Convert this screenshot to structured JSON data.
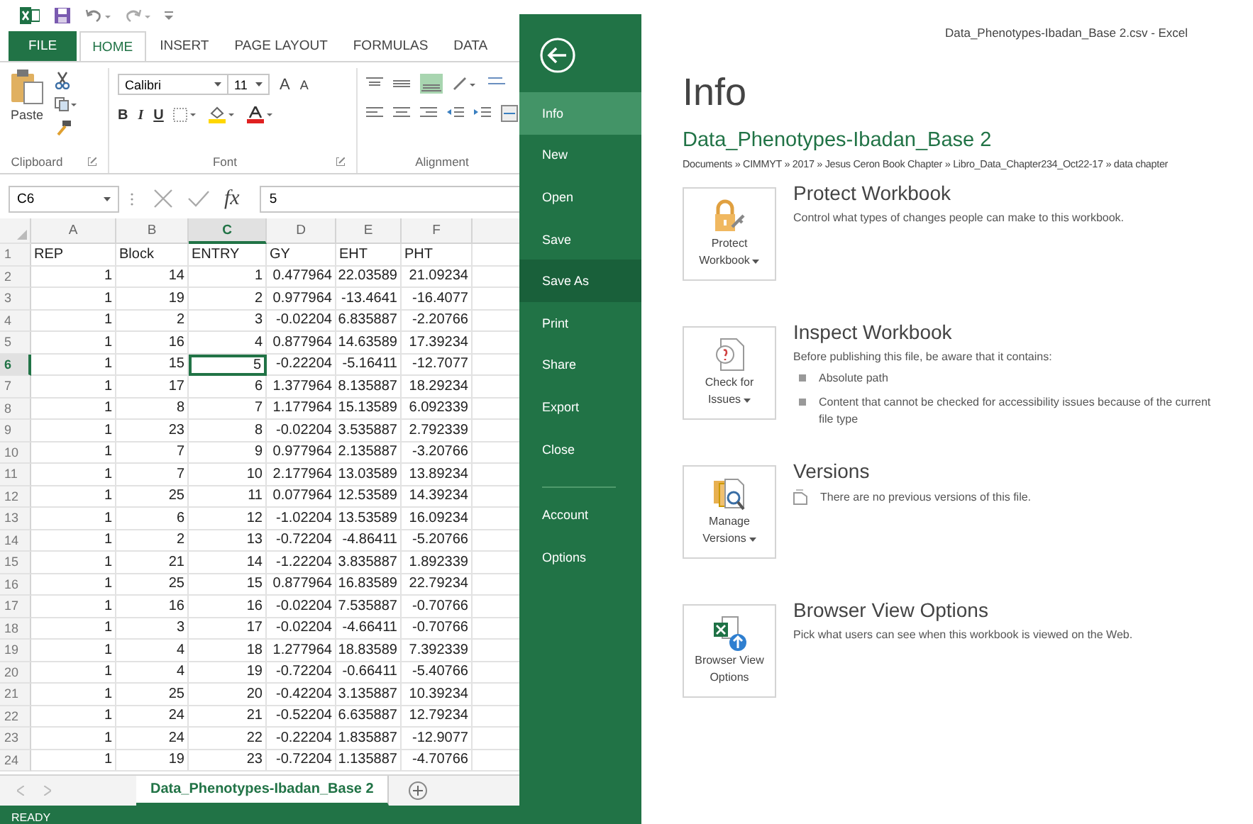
{
  "excel": {
    "ribbon": {
      "tabs": [
        {
          "label": "FILE",
          "kind": "file",
          "selected": false
        },
        {
          "label": "HOME",
          "kind": "tab",
          "selected": true
        },
        {
          "label": "INSERT",
          "kind": "tab",
          "selected": false
        },
        {
          "label": "PAGE LAYOUT",
          "kind": "tab",
          "selected": false
        },
        {
          "label": "FORMULAS",
          "kind": "tab",
          "selected": false
        },
        {
          "label": "DATA",
          "kind": "tab",
          "selected": false
        }
      ],
      "clipboard": {
        "label": "Clipboard",
        "paste": "Paste"
      },
      "font": {
        "label": "Font",
        "name": "Calibri",
        "size": "11",
        "size_buttons": [
          "A",
          "A"
        ],
        "style_buttons": [
          "B",
          "I",
          "U"
        ]
      },
      "alignment": {
        "label": "Alignment"
      }
    },
    "formula_bar": {
      "name_box": "C6",
      "function_label": "fx",
      "value": "5"
    },
    "sheet": {
      "columns": [
        {
          "label": "A",
          "selected": false
        },
        {
          "label": "B",
          "selected": false
        },
        {
          "label": "C",
          "selected": true
        },
        {
          "label": "D",
          "selected": false
        },
        {
          "label": "E",
          "selected": false
        },
        {
          "label": "F",
          "selected": false
        }
      ],
      "rows": [
        {
          "number": "1",
          "kind": "text",
          "selected": false,
          "cells": [
            "REP",
            "Block",
            "ENTRY",
            "GY",
            "EHT",
            "PHT"
          ]
        },
        {
          "number": "2",
          "kind": "number",
          "selected": false,
          "cells": [
            "1",
            "14",
            "1",
            "0.477964",
            "22.03589",
            "21.09234"
          ]
        },
        {
          "number": "3",
          "kind": "number",
          "selected": false,
          "cells": [
            "1",
            "19",
            "2",
            "0.977964",
            "-13.4641",
            "-16.4077"
          ]
        },
        {
          "number": "4",
          "kind": "number",
          "selected": false,
          "cells": [
            "1",
            "2",
            "3",
            "-0.02204",
            "6.835887",
            "-2.20766"
          ]
        },
        {
          "number": "5",
          "kind": "number",
          "selected": false,
          "cells": [
            "1",
            "16",
            "4",
            "0.877964",
            "14.63589",
            "17.39234"
          ]
        },
        {
          "number": "6",
          "kind": "number",
          "selected": true,
          "cells": [
            "1",
            "15",
            "5",
            "-0.22204",
            "-5.16411",
            "-12.7077"
          ]
        },
        {
          "number": "7",
          "kind": "number",
          "selected": false,
          "cells": [
            "1",
            "17",
            "6",
            "1.377964",
            "8.135887",
            "18.29234"
          ]
        },
        {
          "number": "8",
          "kind": "number",
          "selected": false,
          "cells": [
            "1",
            "8",
            "7",
            "1.177964",
            "15.13589",
            "6.092339"
          ]
        },
        {
          "number": "9",
          "kind": "number",
          "selected": false,
          "cells": [
            "1",
            "23",
            "8",
            "-0.02204",
            "3.535887",
            "2.792339"
          ]
        },
        {
          "number": "10",
          "kind": "number",
          "selected": false,
          "cells": [
            "1",
            "7",
            "9",
            "0.977964",
            "2.135887",
            "-3.20766"
          ]
        },
        {
          "number": "11",
          "kind": "number",
          "selected": false,
          "cells": [
            "1",
            "7",
            "10",
            "2.177964",
            "13.03589",
            "13.89234"
          ]
        },
        {
          "number": "12",
          "kind": "number",
          "selected": false,
          "cells": [
            "1",
            "25",
            "11",
            "0.077964",
            "12.53589",
            "14.39234"
          ]
        },
        {
          "number": "13",
          "kind": "number",
          "selected": false,
          "cells": [
            "1",
            "6",
            "12",
            "-1.02204",
            "13.53589",
            "16.09234"
          ]
        },
        {
          "number": "14",
          "kind": "number",
          "selected": false,
          "cells": [
            "1",
            "2",
            "13",
            "-0.72204",
            "-4.86411",
            "-5.20766"
          ]
        },
        {
          "number": "15",
          "kind": "number",
          "selected": false,
          "cells": [
            "1",
            "21",
            "14",
            "-1.22204",
            "3.835887",
            "1.892339"
          ]
        },
        {
          "number": "16",
          "kind": "number",
          "selected": false,
          "cells": [
            "1",
            "25",
            "15",
            "0.877964",
            "16.83589",
            "22.79234"
          ]
        },
        {
          "number": "17",
          "kind": "number",
          "selected": false,
          "cells": [
            "1",
            "16",
            "16",
            "-0.02204",
            "7.535887",
            "-0.70766"
          ]
        },
        {
          "number": "18",
          "kind": "number",
          "selected": false,
          "cells": [
            "1",
            "3",
            "17",
            "-0.02204",
            "-4.66411",
            "-0.70766"
          ]
        },
        {
          "number": "19",
          "kind": "number",
          "selected": false,
          "cells": [
            "1",
            "4",
            "18",
            "1.277964",
            "18.83589",
            "7.392339"
          ]
        },
        {
          "number": "20",
          "kind": "number",
          "selected": false,
          "cells": [
            "1",
            "4",
            "19",
            "-0.72204",
            "-0.66411",
            "-5.40766"
          ]
        },
        {
          "number": "21",
          "kind": "number",
          "selected": false,
          "cells": [
            "1",
            "25",
            "20",
            "-0.42204",
            "3.135887",
            "10.39234"
          ]
        },
        {
          "number": "22",
          "kind": "number",
          "selected": false,
          "cells": [
            "1",
            "24",
            "21",
            "-0.52204",
            "6.635887",
            "12.79234"
          ]
        },
        {
          "number": "23",
          "kind": "number",
          "selected": false,
          "cells": [
            "1",
            "24",
            "22",
            "-0.22204",
            "1.835887",
            "-12.9077"
          ]
        },
        {
          "number": "24",
          "kind": "number",
          "selected": false,
          "cells": [
            "1",
            "19",
            "23",
            "-0.72204",
            "1.135887",
            "-4.70766"
          ]
        }
      ]
    },
    "sheet_tabs": [
      {
        "label": "Data_Phenotypes-Ibadan_Base 2",
        "selected": true
      }
    ],
    "status_bar": "READY"
  },
  "backstage": {
    "window_title": "Data_Phenotypes-Ibadan_Base 2.csv - Excel",
    "nav_main": [
      {
        "label": "Info",
        "selected": true,
        "hovered": false
      },
      {
        "label": "New",
        "selected": false,
        "hovered": false
      },
      {
        "label": "Open",
        "selected": false,
        "hovered": false
      },
      {
        "label": "Save",
        "selected": false,
        "hovered": false
      },
      {
        "label": "Save As",
        "selected": false,
        "hovered": true
      },
      {
        "label": "Print",
        "selected": false,
        "hovered": false
      },
      {
        "label": "Share",
        "selected": false,
        "hovered": false
      },
      {
        "label": "Export",
        "selected": false,
        "hovered": false
      },
      {
        "label": "Close",
        "selected": false,
        "hovered": false
      }
    ],
    "nav_footer": [
      {
        "label": "Account",
        "selected": false,
        "hovered": false
      },
      {
        "label": "Options",
        "selected": false,
        "hovered": false
      }
    ],
    "heading": "Info",
    "document_title": "Data_Phenotypes-Ibadan_Base 2",
    "path": "Documents » CIMMYT » 2017 » Jesus Ceron Book Chapter » Libro_Data_Chapter234_Oct22-17 » data chapter",
    "sections": [
      {
        "button": [
          "Protect",
          "Workbook"
        ],
        "dropdown": true,
        "title": "Protect Workbook",
        "description": "Control what types of changes people can make to this workbook."
      },
      {
        "button": [
          "Check for",
          "Issues"
        ],
        "dropdown": true,
        "title": "Inspect Workbook",
        "description": "Before publishing this file, be aware that it contains:",
        "bullets": [
          "Absolute path",
          "Content that cannot be checked for accessibility issues because of the current file type"
        ]
      },
      {
        "button": [
          "Manage",
          "Versions"
        ],
        "dropdown": true,
        "title": "Versions",
        "note": "There are no previous versions of this file."
      },
      {
        "button": [
          "Browser View",
          "Options"
        ],
        "dropdown": false,
        "title": "Browser View Options",
        "description": "Pick what users can see when this workbook is viewed on the Web."
      }
    ]
  }
}
